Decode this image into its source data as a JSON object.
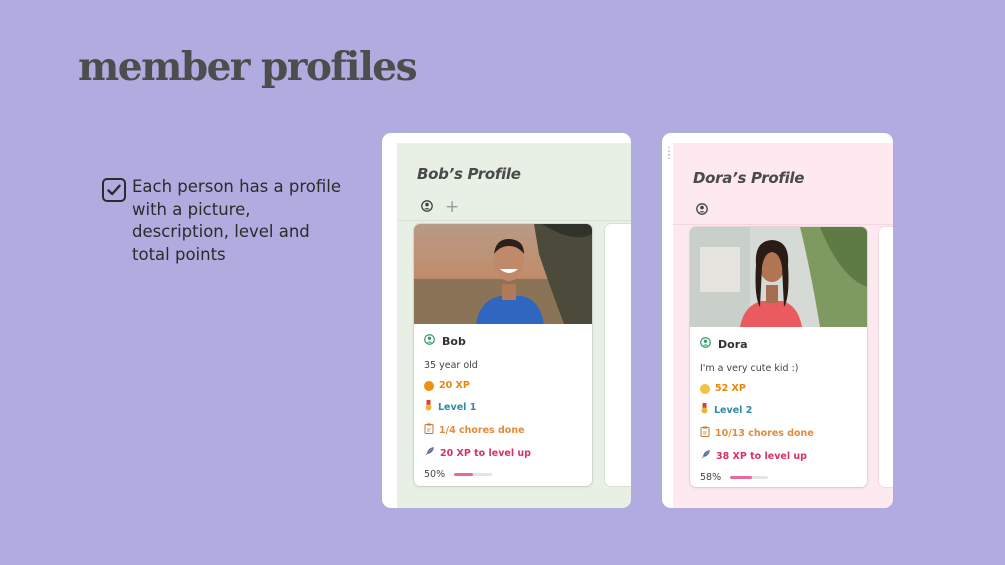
{
  "slide": {
    "title": "member profiles",
    "bullet_text": "Each person has a profile with a picture, description, level and total points"
  },
  "profiles": [
    {
      "title": "Bob’s Profile",
      "card": {
        "name": "Bob",
        "description": "35 year old",
        "xp": "20 XP",
        "level": "Level 1",
        "chores": "1/4 chores done",
        "xp_to_level": "20 XP to level up",
        "progress_label": "50%",
        "progress": 0.5
      }
    },
    {
      "title": "Dora’s Profile",
      "card": {
        "name": "Dora",
        "description": "I'm a very cute kid :)",
        "xp": "52 XP",
        "level": "Level 2",
        "chores": "10/13 chores done",
        "xp_to_level": "38 XP to level up",
        "progress_label": "58%",
        "progress": 0.58
      }
    }
  ],
  "colors": {
    "background": "#b0acdf",
    "bob_panel": "#e8efe4",
    "dora_panel": "#fde9ef",
    "xp_bob": "#f0900e",
    "xp_dora": "#f6c244",
    "progress": "#e66aa0"
  }
}
